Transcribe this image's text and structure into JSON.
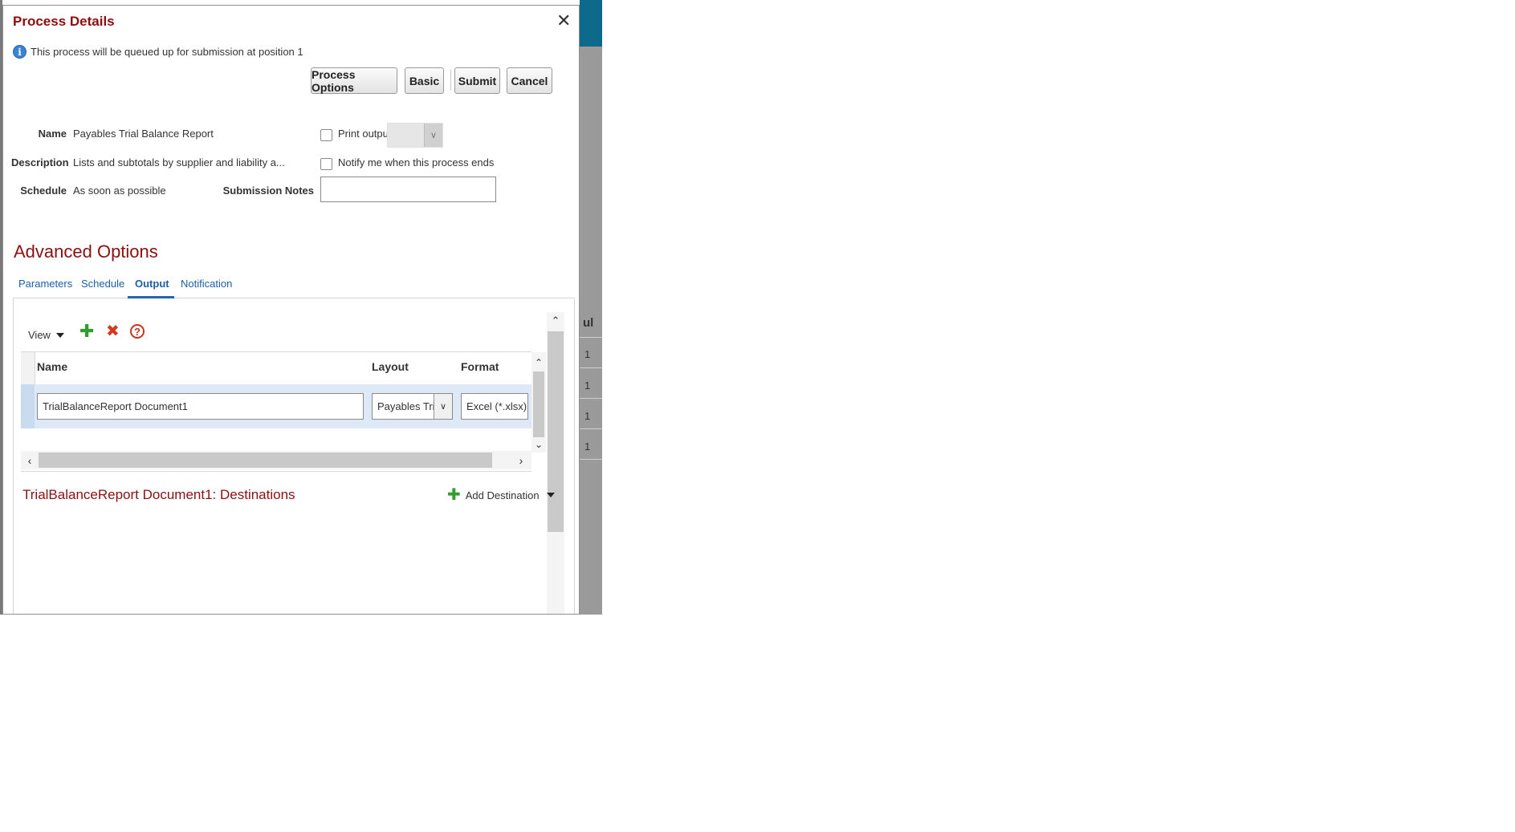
{
  "dialog": {
    "title": "Process Details",
    "close_glyph": "✕",
    "info_icon": "info-icon",
    "info_text": "This process will be queued up for submission at position 1"
  },
  "buttons": {
    "process_options": "Process Options",
    "basic": "Basic",
    "submit": "Submit",
    "cancel": "Cancel"
  },
  "form": {
    "name_label": "Name",
    "name_value": "Payables Trial Balance Report",
    "description_label": "Description",
    "description_value": "Lists and subtotals by supplier and liability a...",
    "schedule_label": "Schedule",
    "schedule_value": "As soon as possible",
    "print_output_label": "Print output",
    "notify_label": "Notify me when this process ends",
    "submission_notes_label": "Submission Notes",
    "submission_notes_value": ""
  },
  "advanced": {
    "title": "Advanced Options",
    "tabs": [
      {
        "label": "Parameters"
      },
      {
        "label": "Schedule"
      },
      {
        "label": "Output"
      },
      {
        "label": "Notification"
      }
    ],
    "active_tab": "Output"
  },
  "output_toolbar": {
    "view_label": "View",
    "add_icon": "plus-icon",
    "delete_icon": "delete-x-icon",
    "help_icon": "help-icon"
  },
  "output_table": {
    "columns": [
      "Name",
      "Layout",
      "Format"
    ],
    "rows": [
      {
        "name": "TrialBalanceReport Document1",
        "layout": "Payables Tria",
        "format": "Excel (*.xlsx)"
      }
    ]
  },
  "destinations": {
    "title": "TrialBalanceReport Document1: Destinations",
    "add_label": "Add Destination"
  },
  "background": {
    "header_fragment": "ul",
    "row_values": [
      "1",
      "1",
      "1",
      "1"
    ]
  },
  "colors": {
    "title_red": "#8b0f0f",
    "link_blue": "#1d5fa8",
    "selected_row": "#dde9f6",
    "brand_bar": "#0e6a8a"
  }
}
